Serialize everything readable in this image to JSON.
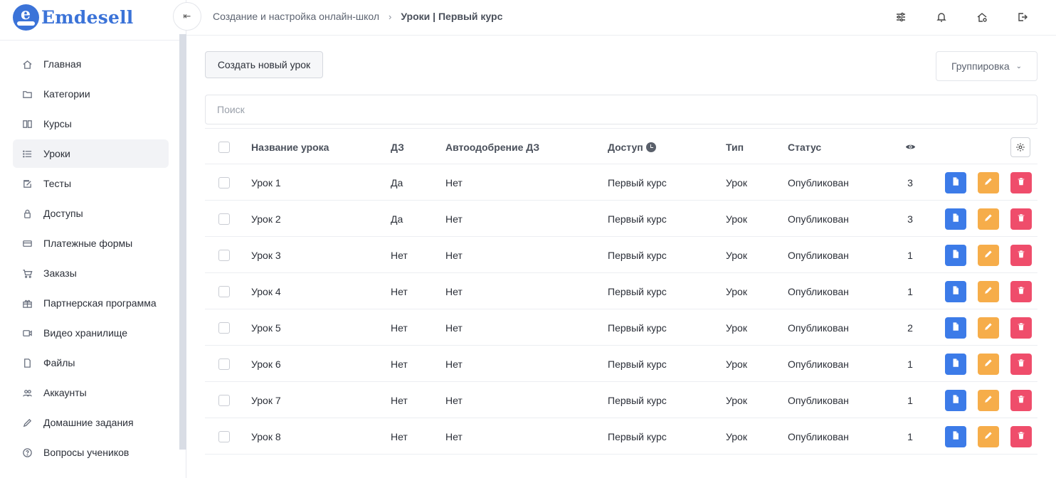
{
  "app": {
    "logo_text": "Emdesell",
    "logo_letter": "e"
  },
  "sidebar": {
    "items": [
      {
        "label": "Главная",
        "icon": "home-icon"
      },
      {
        "label": "Категории",
        "icon": "folder-icon"
      },
      {
        "label": "Курсы",
        "icon": "book-icon"
      },
      {
        "label": "Уроки",
        "icon": "list-icon",
        "active": true
      },
      {
        "label": "Тесты",
        "icon": "edit-square-icon"
      },
      {
        "label": "Доступы",
        "icon": "lock-icon"
      },
      {
        "label": "Платежные формы",
        "icon": "credit-card-icon"
      },
      {
        "label": "Заказы",
        "icon": "cart-icon"
      },
      {
        "label": "Партнерская программа",
        "icon": "gift-icon"
      },
      {
        "label": "Видео хранилище",
        "icon": "video-icon"
      },
      {
        "label": "Файлы",
        "icon": "file-icon"
      },
      {
        "label": "Аккаунты",
        "icon": "users-icon"
      },
      {
        "label": "Домашние задания",
        "icon": "pencil-icon"
      },
      {
        "label": "Вопросы учеников",
        "icon": "question-icon"
      }
    ]
  },
  "header": {
    "collapse_glyph": "⇤",
    "breadcrumb": {
      "parent": "Создание и настройка онлайн-школ",
      "separator": "›",
      "current": "Уроки | Первый курс"
    },
    "icons": [
      "sliders-icon",
      "bell-icon",
      "home-settings-icon",
      "logout-icon"
    ]
  },
  "toolbar": {
    "create_label": "Создать новый урок",
    "group_label": "Группировка",
    "group_chevron": "⌄"
  },
  "search": {
    "placeholder": "Поиск",
    "value": ""
  },
  "table": {
    "headers": {
      "name": "Название урока",
      "hw": "ДЗ",
      "auto": "Автоодобрение ДЗ",
      "access": "Доступ",
      "type": "Тип",
      "status": "Статус"
    },
    "rows": [
      {
        "name": "Урок 1",
        "hw": "Да",
        "auto": "Нет",
        "access": "Первый курс",
        "type": "Урок",
        "status": "Опубликован",
        "views": "3"
      },
      {
        "name": "Урок 2",
        "hw": "Да",
        "auto": "Нет",
        "access": "Первый курс",
        "type": "Урок",
        "status": "Опубликован",
        "views": "3"
      },
      {
        "name": "Урок 3",
        "hw": "Нет",
        "auto": "Нет",
        "access": "Первый курс",
        "type": "Урок",
        "status": "Опубликован",
        "views": "1"
      },
      {
        "name": "Урок 4",
        "hw": "Нет",
        "auto": "Нет",
        "access": "Первый курс",
        "type": "Урок",
        "status": "Опубликован",
        "views": "1"
      },
      {
        "name": "Урок 5",
        "hw": "Нет",
        "auto": "Нет",
        "access": "Первый курс",
        "type": "Урок",
        "status": "Опубликован",
        "views": "2"
      },
      {
        "name": "Урок 6",
        "hw": "Нет",
        "auto": "Нет",
        "access": "Первый курс",
        "type": "Урок",
        "status": "Опубликован",
        "views": "1"
      },
      {
        "name": "Урок 7",
        "hw": "Нет",
        "auto": "Нет",
        "access": "Первый курс",
        "type": "Урок",
        "status": "Опубликован",
        "views": "1"
      },
      {
        "name": "Урок 8",
        "hw": "Нет",
        "auto": "Нет",
        "access": "Первый курс",
        "type": "Урок",
        "status": "Опубликован",
        "views": "1"
      }
    ]
  },
  "colors": {
    "brand": "#3b73d8",
    "view": "#3c7be8",
    "edit": "#f6ad4a",
    "delete": "#ef4d6b"
  }
}
